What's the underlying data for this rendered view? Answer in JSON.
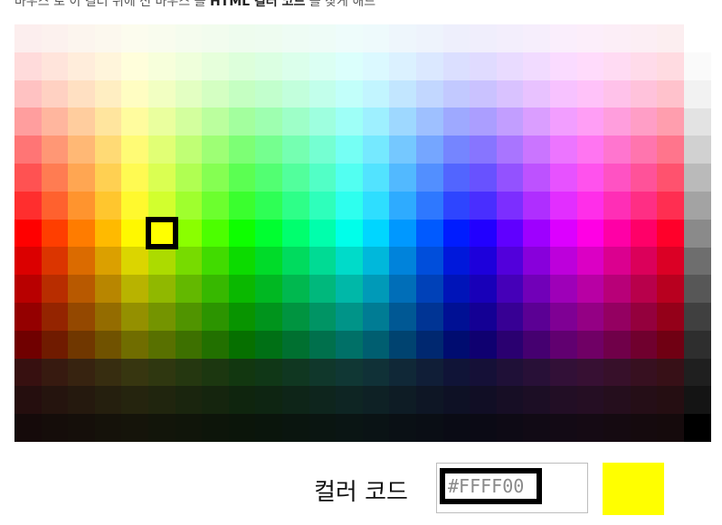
{
  "header": {
    "note_prefix": "마우스 로 이 컬러 위에 선 마우스 를",
    "note_bold": "HTML 컬러 코드",
    "note_suffix": "를 찾게 해드"
  },
  "palette": {
    "columns": 25,
    "rows": 15,
    "gray_levels": [
      "#fafafa",
      "#f2f2f2",
      "#e3e3e3",
      "#d1d1d1",
      "#bababa",
      "#a3a3a3",
      "#8a8a8a",
      "#6e6e6e",
      "#575757",
      "#404040",
      "#2e2e2e",
      "#1f1f1f",
      "#141414",
      "#000000"
    ],
    "selected": {
      "row": 7,
      "col": 5
    }
  },
  "picker": {
    "label": "컬러 코드",
    "code_value": "#FFFF00",
    "preview_color": "#ffff00"
  }
}
